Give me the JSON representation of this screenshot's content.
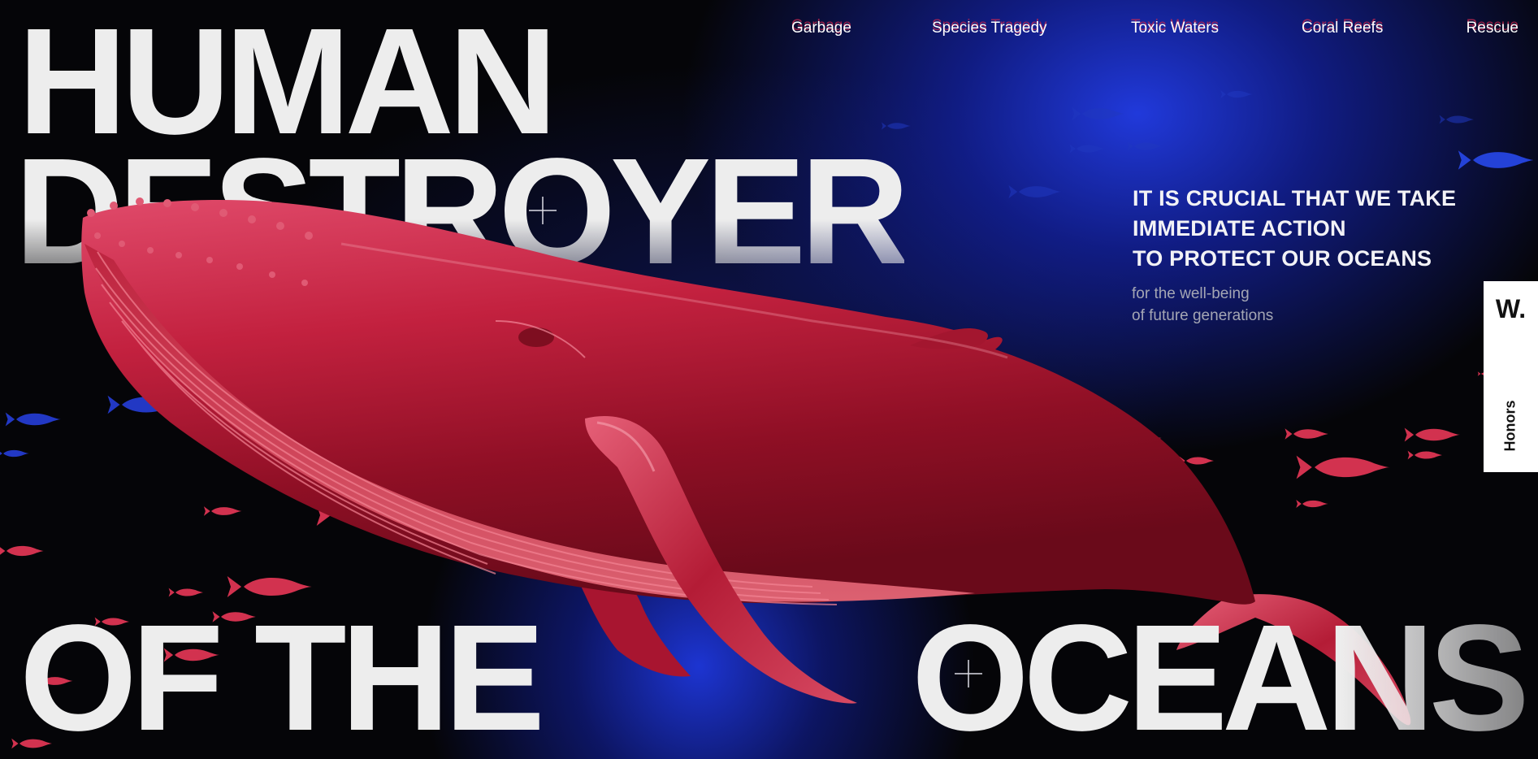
{
  "hero": {
    "line1": "HUMAN",
    "line2": "DESTROYER",
    "line3": "OF THE",
    "line4": "OCEANS"
  },
  "nav": {
    "items": [
      {
        "label": "Garbage"
      },
      {
        "label": "Species Tragedy"
      },
      {
        "label": "Toxic Waters"
      },
      {
        "label": "Coral Reefs"
      },
      {
        "label": "Rescue"
      }
    ]
  },
  "message": {
    "headline": [
      "IT IS CRUCIAL THAT WE TAKE",
      "IMMEDIATE ACTION",
      "TO PROTECT OUR OCEANS"
    ],
    "subline": [
      "for the well-being",
      "of future generations"
    ]
  },
  "honors": {
    "logo": "W.",
    "label": "Honors"
  },
  "colors": {
    "background": "#050508",
    "ocean_blue": "#1a2fd6",
    "whale_red": "#c2213f",
    "fish_red": "#d2324f",
    "fish_blue": "#2238c4",
    "headline_text": "#ededed"
  },
  "icons": {
    "crosshair": "plus-crosshair-icon",
    "whale": "whale-illustration",
    "fish": "fish-icon"
  }
}
